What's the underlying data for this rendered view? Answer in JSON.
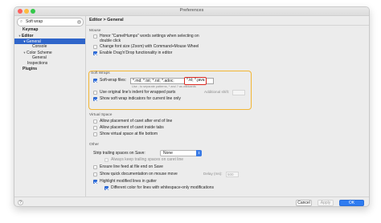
{
  "window": {
    "title": "Preferences"
  },
  "search": {
    "value": "Soft wrap"
  },
  "sidebar": {
    "items": [
      {
        "label": "Keymap"
      },
      {
        "label": "Editor"
      },
      {
        "label": "General"
      },
      {
        "label": "Console"
      },
      {
        "label": "Color Scheme"
      },
      {
        "label": "General"
      },
      {
        "label": "Inspections"
      },
      {
        "label": "Plugins"
      }
    ]
  },
  "breadcrumb": "Editor  >  General",
  "mouse": {
    "title": "Mouse",
    "honor_camel_1": "Honor \"CamelHumps\" words settings when selecting on",
    "honor_camel_2": "double click",
    "change_font": "Change font size (Zoom) with Command+Mouse Wheel",
    "drag_drop": "Enable Drag'n'Drop functionality in editor"
  },
  "soft_wraps": {
    "title": "Soft Wraps",
    "files_label": "Soft-wrap files:",
    "files_value": "*.md; *.txt; *.rst; *.adoc;",
    "files_highlight": "*.kt; *.java",
    "hint": "Use ; to separate patterns, * and ? as wildcards",
    "use_original_indent": "Use original line's indent for wrapped parts",
    "additional_shift": "Additional shift:",
    "show_indicators": "Show soft wrap indicators for current line only"
  },
  "virtual_space": {
    "title": "Virtual Space",
    "after_end_of_line": "Allow placement of caret after end of line",
    "inside_tabs": "Allow placement of caret inside tabs",
    "virtual_space_at_bottom": "Show virtual space at file bottom"
  },
  "other": {
    "title": "Other",
    "strip_label": "Strip trailing spaces on Save:",
    "strip_value": "None",
    "always_keep": "Always keep trailing spaces on caret line",
    "ensure_line_feed": "Ensure line feed at file end on Save",
    "quick_doc": "Show quick documentation on mouse move",
    "delay_label": "Delay (ms):",
    "delay_value": "500",
    "highlight_gutter": "Highlight modified lines in gutter",
    "different_color": "Different color for lines with whitespace-only modifications"
  },
  "footer": {
    "help": "?",
    "cancel": "Cancel",
    "apply": "Apply",
    "ok": "OK"
  },
  "colors": {
    "accent": "#2f7cf1",
    "selection": "#2f65ca",
    "highlight_orange": "#f2b533",
    "highlight_red": "#d9271f"
  }
}
